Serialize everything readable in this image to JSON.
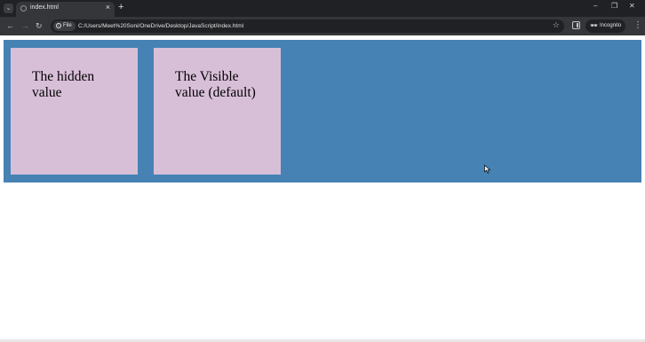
{
  "browser": {
    "tab": {
      "title": "index.html",
      "close_glyph": "×"
    },
    "new_tab_glyph": "+",
    "tab_search_glyph": "⌄",
    "window_controls": {
      "minimize": "–",
      "restore": "❐",
      "close": "✕"
    },
    "nav": {
      "back_glyph": "←",
      "forward_glyph": "→",
      "reload_glyph": "↻"
    },
    "address_bar": {
      "chip_label": "File",
      "url": "C:/Users/Meet%20Soni/OneDrive/Desktop/JavaScript/index.html"
    },
    "incognito_label": "Incognito",
    "icons": {
      "info": "info-icon",
      "star": "star-icon",
      "side-panel": "side-panel-icon",
      "incognito": "incognito-icon",
      "menu": "kebab-menu-icon"
    }
  },
  "page": {
    "container_color": "#4682b4",
    "box_color": "#d8bfd8",
    "boxes": [
      {
        "text": "The hidden value"
      },
      {
        "text": "The Visible value (default)"
      }
    ]
  }
}
